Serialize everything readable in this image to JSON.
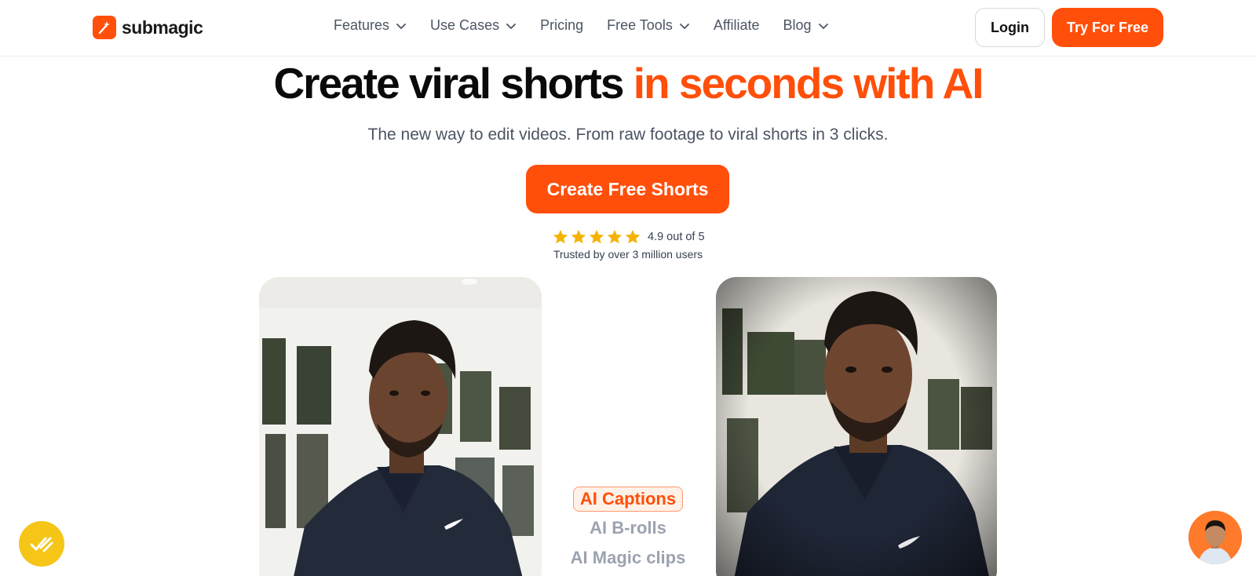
{
  "brand": {
    "name": "submagic",
    "color": "#ff4f0a"
  },
  "nav": {
    "items": [
      {
        "label": "Features",
        "has_dropdown": true
      },
      {
        "label": "Use Cases",
        "has_dropdown": true
      },
      {
        "label": "Pricing",
        "has_dropdown": false
      },
      {
        "label": "Free Tools",
        "has_dropdown": true
      },
      {
        "label": "Affiliate",
        "has_dropdown": false
      },
      {
        "label": "Blog",
        "has_dropdown": true
      }
    ],
    "login_label": "Login",
    "try_label": "Try For Free"
  },
  "hero": {
    "title_main": "Create viral shorts",
    "title_accent": "in seconds with AI",
    "subtitle": "The new way to edit videos. From raw footage to viral shorts in 3 clicks.",
    "cta_label": "Create Free Shorts",
    "rating": {
      "stars": 5,
      "text": "4.9 out of 5"
    },
    "trusted": "Trusted by over 3 million users"
  },
  "features": {
    "items": [
      "AI Captions",
      "AI B-rolls",
      "AI Magic clips"
    ],
    "active_index": 0
  },
  "icons": {
    "logo": "magic-wand-icon",
    "dropdown": "chevron-down-icon",
    "star": "star-icon",
    "chat": "chat-check-icon",
    "support": "support-avatar"
  }
}
